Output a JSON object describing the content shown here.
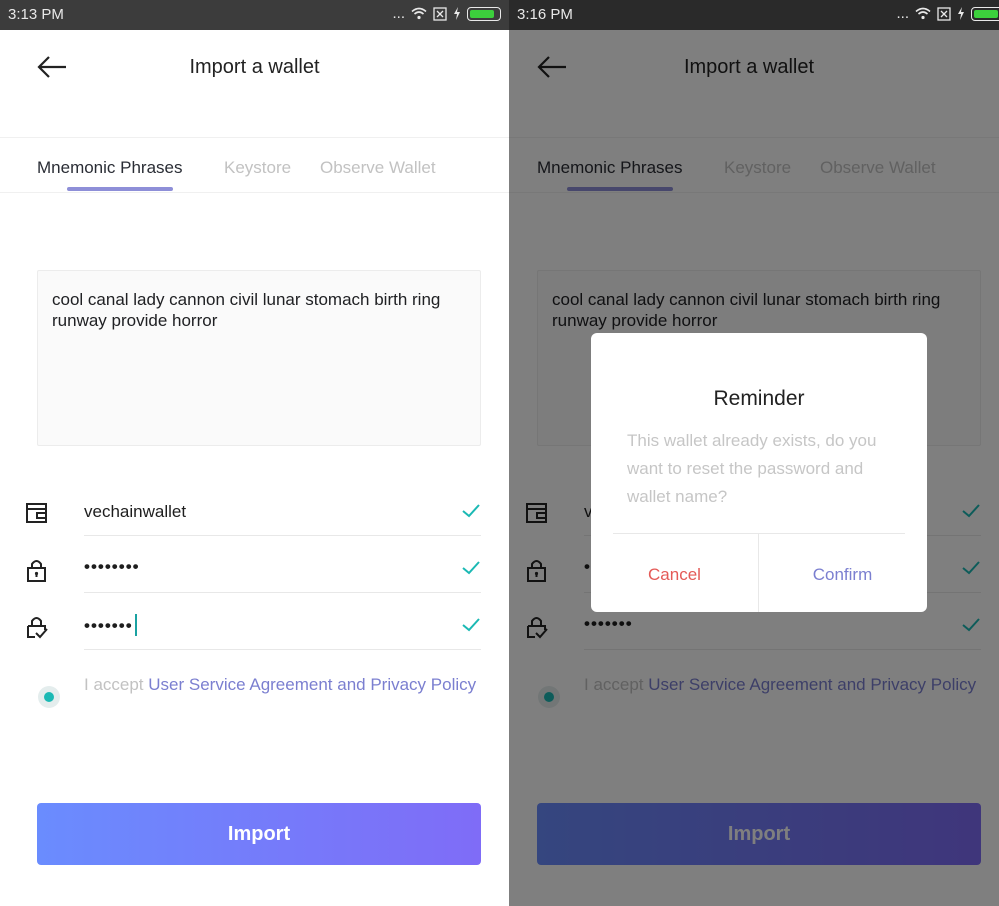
{
  "colors": {
    "accent": "#7b7fd0",
    "check": "#1bb9b4",
    "cancel": "#e45a57",
    "button_gradient_start": "#6a8cfe",
    "button_gradient_end": "#7f6cf7"
  },
  "left": {
    "status": {
      "time": "3:13 PM",
      "dots": "..."
    },
    "header": {
      "title": "Import a wallet",
      "back_icon": "arrow-left-icon"
    },
    "tabs": [
      {
        "label": "Mnemonic Phrases",
        "active": true
      },
      {
        "label": "Keystore",
        "active": false
      },
      {
        "label": "Observe Wallet",
        "active": false
      }
    ],
    "mnemonic": "cool canal lady cannon civil lunar stomach birth ring runway provide horror",
    "fields": {
      "wallet_name": "vechainwallet",
      "password": "••••••••",
      "confirm_password": "•••••••"
    },
    "agreement": {
      "prefix": "I accept ",
      "link": "User Service Agreement and Privacy Policy"
    },
    "import_label": "Import"
  },
  "right": {
    "status": {
      "time": "3:16 PM",
      "dots": "..."
    },
    "header": {
      "title": "Import a wallet"
    },
    "tabs": [
      {
        "label": "Mnemonic Phrases",
        "active": true
      },
      {
        "label": "Keystore",
        "active": false
      },
      {
        "label": "Observe Wallet",
        "active": false
      }
    ],
    "mnemonic": "cool canal lady cannon civil lunar stomach birth ring runway provide horror",
    "fields": {
      "wallet_name_partial": "v",
      "password_partial": "•",
      "confirm_password": "•••••••"
    },
    "agreement": {
      "prefix": "I accept ",
      "link": "User Service Agreement and Privacy Policy"
    },
    "import_label": "Import",
    "dialog": {
      "title": "Reminder",
      "message": "This wallet already exists, do you want to reset the password and wallet name?",
      "cancel": "Cancel",
      "confirm": "Confirm"
    }
  }
}
